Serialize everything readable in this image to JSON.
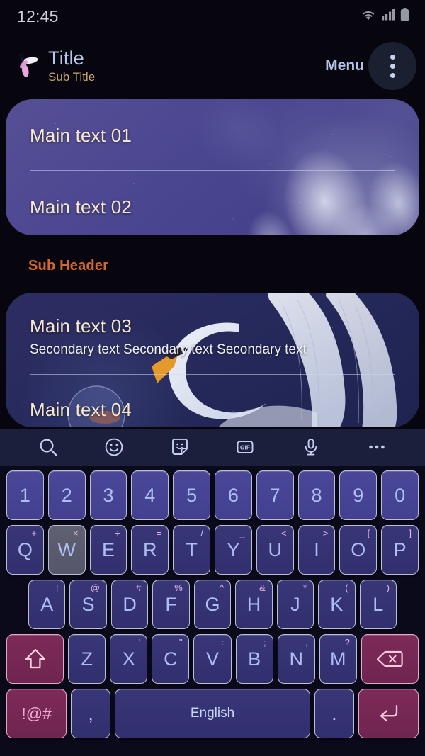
{
  "status_bar": {
    "time": "12:45",
    "icons": [
      "wifi-icon",
      "cellular-signal-icon",
      "battery-icon"
    ]
  },
  "app_bar": {
    "logo": "moth-logo-icon",
    "title": "Title",
    "subtitle": "Sub Title",
    "menu_label": "Menu",
    "overflow_icon": "more-vertical-icon"
  },
  "content": {
    "card_one": {
      "rows": [
        {
          "main": "Main text 01"
        },
        {
          "main": "Main text 02"
        }
      ]
    },
    "sub_header": "Sub Header",
    "card_two": {
      "rows": [
        {
          "main": "Main text 03",
          "secondary": "Secondary text Secondary text Secondary text"
        },
        {
          "main": "Main text 04"
        }
      ]
    }
  },
  "keyboard": {
    "toolbar": [
      {
        "name": "search-icon"
      },
      {
        "name": "emoji-icon"
      },
      {
        "name": "sticker-icon"
      },
      {
        "name": "gif-icon",
        "label": "GIF"
      },
      {
        "name": "microphone-icon"
      },
      {
        "name": "more-options-icon"
      }
    ],
    "rows": [
      {
        "id": "number-row",
        "keys": [
          {
            "label": "1"
          },
          {
            "label": "2"
          },
          {
            "label": "3"
          },
          {
            "label": "4"
          },
          {
            "label": "5"
          },
          {
            "label": "6"
          },
          {
            "label": "7"
          },
          {
            "label": "8"
          },
          {
            "label": "9"
          },
          {
            "label": "0"
          }
        ]
      },
      {
        "id": "qwerty-row",
        "keys": [
          {
            "label": "Q",
            "sup": "+"
          },
          {
            "label": "W",
            "sup": "×",
            "state": "pressed"
          },
          {
            "label": "E",
            "sup": "÷"
          },
          {
            "label": "R",
            "sup": "="
          },
          {
            "label": "T",
            "sup": "/"
          },
          {
            "label": "Y",
            "sup": "_"
          },
          {
            "label": "U",
            "sup": "<"
          },
          {
            "label": "I",
            "sup": ">"
          },
          {
            "label": "O",
            "sup": "["
          },
          {
            "label": "P",
            "sup": "]"
          }
        ]
      },
      {
        "id": "asdf-row",
        "keys": [
          {
            "label": "A",
            "sup": "!"
          },
          {
            "label": "S",
            "sup": "@"
          },
          {
            "label": "D",
            "sup": "#"
          },
          {
            "label": "F",
            "sup": "%"
          },
          {
            "label": "G",
            "sup": "^"
          },
          {
            "label": "H",
            "sup": "&"
          },
          {
            "label": "J",
            "sup": "*"
          },
          {
            "label": "K",
            "sup": "("
          },
          {
            "label": "L",
            "sup": ")"
          }
        ]
      },
      {
        "id": "zxcv-row",
        "keys": [
          {
            "label": "",
            "icon": "shift-icon",
            "variant": "accent",
            "width": "w2"
          },
          {
            "label": "Z",
            "sup": "-"
          },
          {
            "label": "X",
            "sup": "'"
          },
          {
            "label": "C",
            "sup": "\""
          },
          {
            "label": "V",
            "sup": ":"
          },
          {
            "label": "B",
            "sup": ";"
          },
          {
            "label": "N",
            "sup": ","
          },
          {
            "label": "M",
            "sup": "?"
          },
          {
            "label": "",
            "icon": "backspace-icon",
            "variant": "accent",
            "width": "w2"
          }
        ]
      },
      {
        "id": "bottom-row",
        "keys": [
          {
            "label": "!@#",
            "variant": "accent symbols",
            "width": "w2"
          },
          {
            "label": ",",
            "variant": "punct"
          },
          {
            "label": "English",
            "variant": "space",
            "width": "space"
          },
          {
            "label": ".",
            "variant": "punct"
          },
          {
            "label": "",
            "icon": "enter-icon",
            "variant": "accent",
            "width": "w2"
          }
        ]
      }
    ]
  },
  "colors": {
    "background": "#07060f",
    "card_one": "#4a4690",
    "card_two": "#272a5c",
    "title": "#b9c6ee",
    "subtitle": "#c9a86a",
    "sub_header": "#d2682a",
    "main_text": "#f6e8cf",
    "key_face": "#434090",
    "key_accent": "#7d2a58",
    "keyboard_toolbar": "#1c1f3c"
  }
}
